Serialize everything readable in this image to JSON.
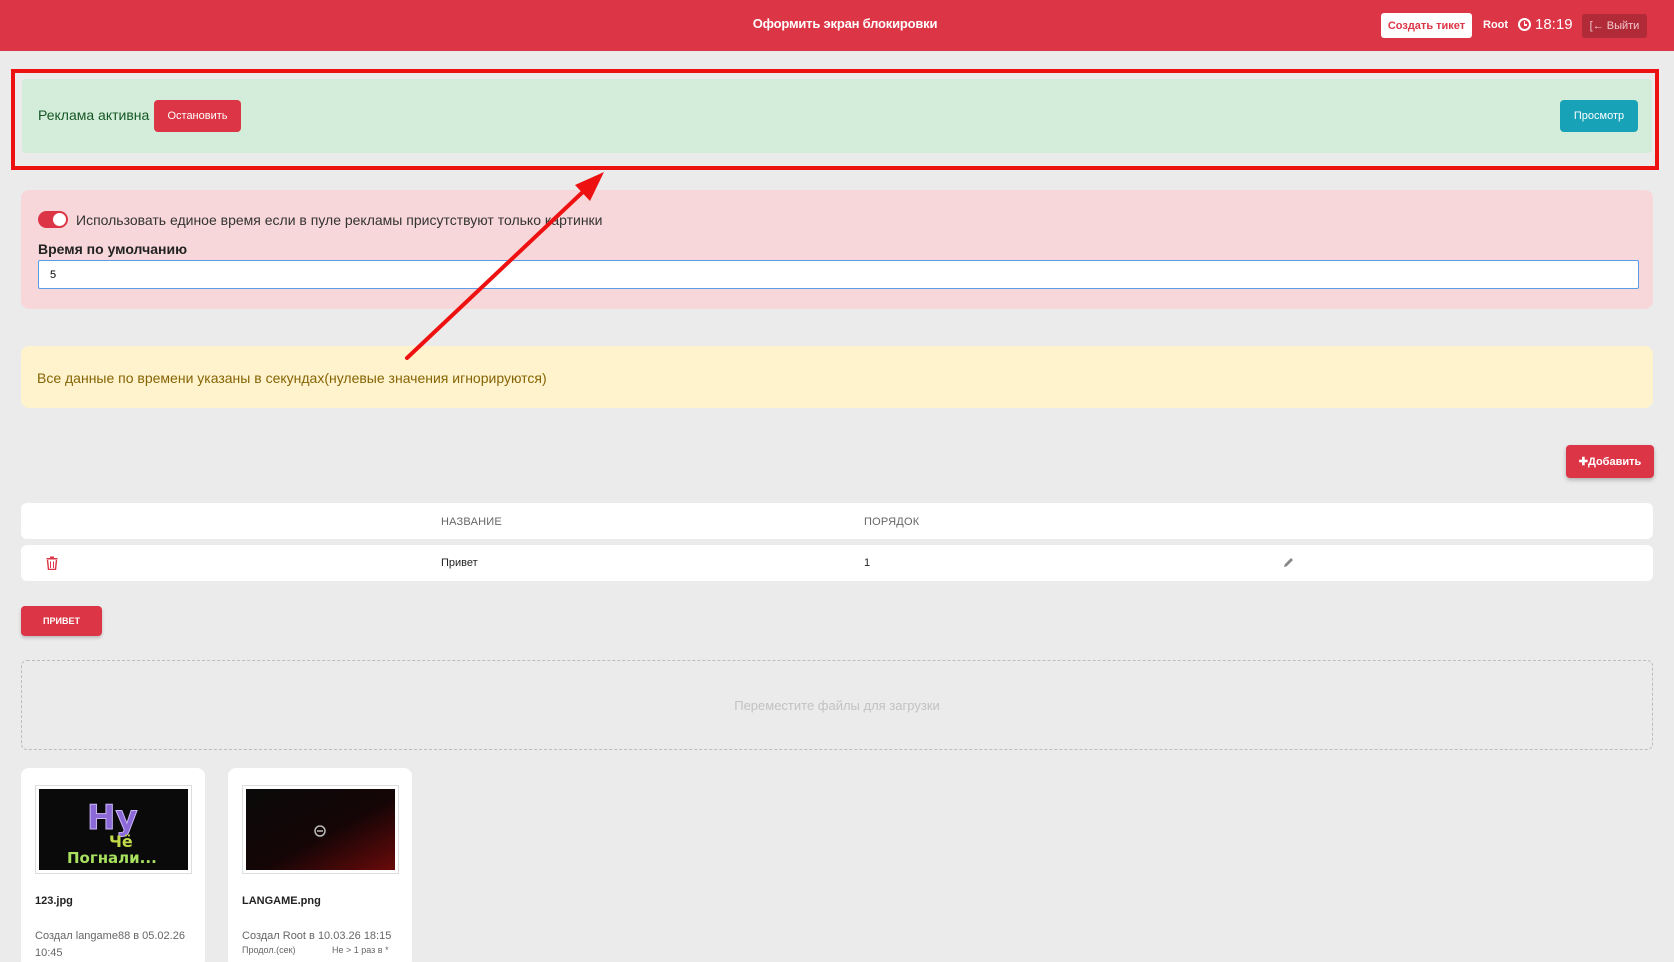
{
  "header": {
    "title": "Оформить экран блокировки",
    "create_ticket_label": "Создать тикет",
    "user": "Root",
    "time": "18:19",
    "logout_label": "Выйти"
  },
  "ads": {
    "status_text": "Реклама активна",
    "stop_label": "Остановить",
    "preview_label": "Просмотр"
  },
  "settings": {
    "toggle_label": "Использовать единое время если в пуле рекламы присутствуют только картинки",
    "toggle_on": true,
    "default_time_label": "Время по умолчанию",
    "default_time_value": "5"
  },
  "info": {
    "text": "Все данные по времени указаны в секундах(нулевые значения игнорируются)"
  },
  "toolbar": {
    "add_label": "Добавить"
  },
  "table": {
    "headers": [
      "НАЗВАНИЕ",
      "ПОРЯДОК"
    ],
    "rows": [
      {
        "name": "Привет",
        "order": "1"
      }
    ]
  },
  "group": {
    "label": "привет"
  },
  "dropzone": {
    "text": "Переместите файлы для загрузки"
  },
  "files": [
    {
      "name": "123.jpg",
      "meta": "Создал langame88 в 05.02.26 10:45",
      "thumb_text_1": "Ну",
      "thumb_text_2": "Чё",
      "thumb_text_3": "Погнали..."
    },
    {
      "name": "LANGAME.png",
      "meta": "Создал Root в 10.03.26 18:15",
      "duration_label": "Продол.(сек)",
      "repeat_label": "Не > 1 раз в *"
    }
  ],
  "colors": {
    "brand_red": "#dc3545",
    "success_bg": "#d4edda",
    "danger_bg": "#f8d7da",
    "warning_bg": "#fff3cd",
    "info_button": "#17a2b8"
  }
}
